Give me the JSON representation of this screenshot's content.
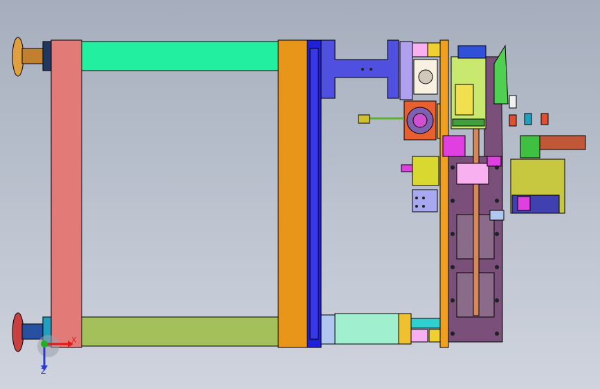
{
  "viewport": {
    "background_top": "#a6aebd",
    "background_bottom": "#cfd4de"
  },
  "triad": {
    "x_label": "X",
    "z_label": "Z",
    "x_color": "#e01818",
    "z_color": "#2a3ad0",
    "origin_color": "#20b020"
  },
  "colors": {
    "post_left": "#e27b78",
    "post_right": "#e8961a",
    "rail_top": "#22f0a0",
    "rail_bottom": "#a4c05a",
    "blue_plate": "#2020d8",
    "mount_blue": "#5050e0",
    "purple_plate": "#7a4f7a",
    "slide_orange": "#f0a020",
    "cylinder": "#a0f0d0",
    "motor_green": "#c8e870",
    "magenta": "#e040e0",
    "pink": "#f8b0f0",
    "olive": "#c8c840",
    "rod": "#d88858",
    "foot_orange": "#e0a040",
    "foot_red": "#c84040"
  }
}
